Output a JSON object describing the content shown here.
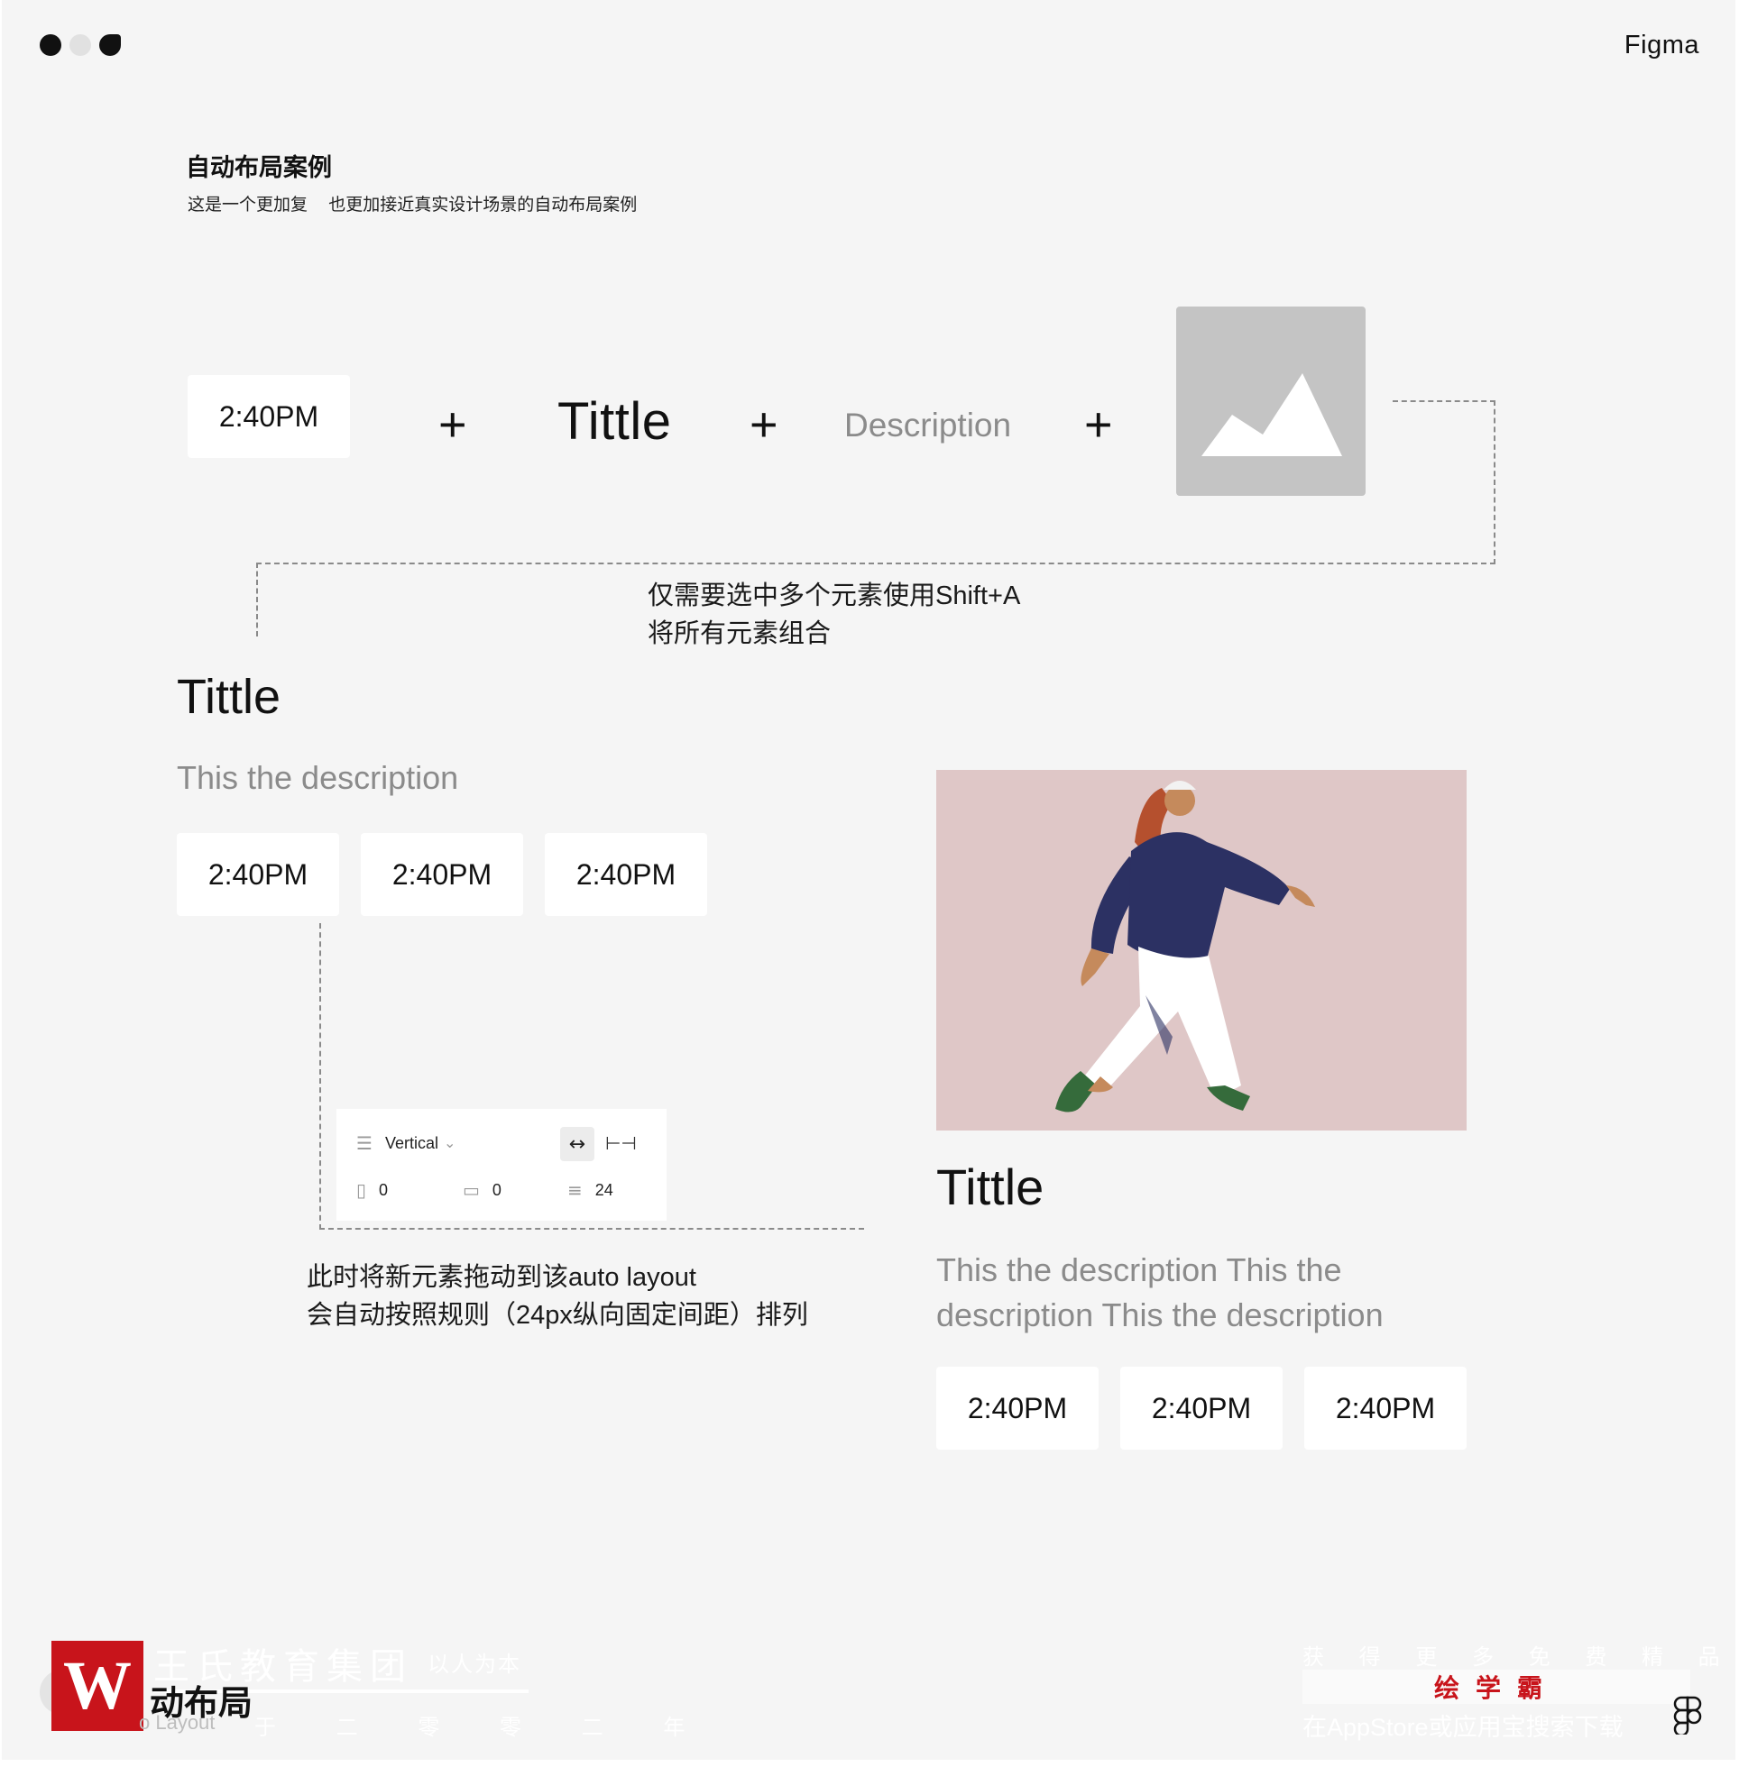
{
  "window": {
    "brand": "Figma"
  },
  "header": {
    "title": "自动布局案例",
    "subtitle": "这是一个更加复 也更加接近真实设计场景的自动布局案例"
  },
  "components_row": {
    "time_label": "2:40PM",
    "plus_symbol": "+",
    "title": "Tittle",
    "description": "Description",
    "image_icon": "image-placeholder-icon"
  },
  "note1": {
    "line1": "仅需要选中多个元素使用Shift+A",
    "line2": "将所有元素组合"
  },
  "left_card": {
    "title": "Tittle",
    "description": "This the description",
    "times": [
      "2:40PM",
      "2:40PM",
      "2:40PM"
    ]
  },
  "auto_layout_panel": {
    "direction": "Vertical",
    "chevron": "⌄",
    "padding_horizontal": "0",
    "padding_vertical": "0",
    "spacing": "24",
    "icons": [
      "direction-vertical-icon",
      "hug-width-icon",
      "fixed-width-icon",
      "horizontal-padding-icon",
      "vertical-padding-icon",
      "item-spacing-icon"
    ]
  },
  "note2": {
    "line1": "此时将新元素拖动到该auto layout",
    "line2": "会自动按照规则（24px纵向固定间距）排列"
  },
  "right_card": {
    "title": "Tittle",
    "description": "This the description This the description This the description",
    "times": [
      "2:40PM",
      "2:40PM",
      "2:40PM"
    ]
  },
  "watermark": {
    "logo_letter": "W",
    "company": "王氏教育集团",
    "motto": "以人为本",
    "layout_cn": "动布局",
    "layout_en": "o Layout",
    "year": "于 二 零 零 二 年",
    "promo1": "获 得 更 多 免 费 精 品 教 程",
    "promo2": "绘学霸",
    "promo3": "在AppStore或应用宝搜索下载"
  },
  "colors": {
    "canvas": "#f5f5f5",
    "card": "#ffffff",
    "muted_text": "#8b8b8b",
    "placeholder": "#c4c4c4",
    "photo_bg": "#dfc7c7",
    "brand_red": "#c8141b"
  }
}
